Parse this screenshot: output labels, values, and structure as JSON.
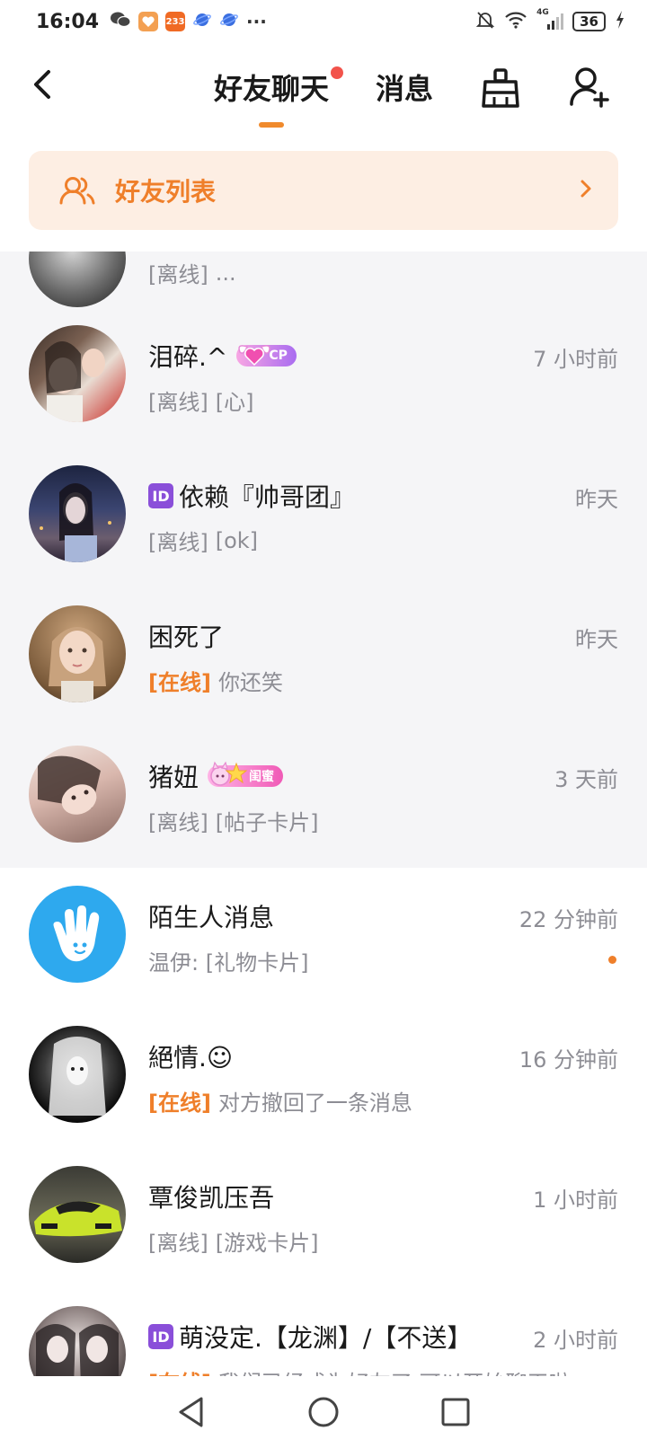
{
  "status_bar": {
    "time": "16:04",
    "badge_233": "233",
    "dots": "···",
    "network": "4G",
    "battery": "36"
  },
  "header": {
    "tabs": [
      {
        "label": "好友聊天",
        "active": true,
        "has_dot": true
      },
      {
        "label": "消息",
        "active": false
      }
    ]
  },
  "friend_list_banner": {
    "label": "好友列表"
  },
  "conversations": [
    {
      "partial": true,
      "name": "",
      "status": "[离线]",
      "preview": "...",
      "time": ""
    },
    {
      "name": "泪碎.^",
      "badge": "CP",
      "status": "[离线]",
      "preview": "[心]",
      "time": "7 小时前"
    },
    {
      "name": "依赖『帅哥团』",
      "id_badge": "ID",
      "status": "[离线]",
      "preview": "[ok]",
      "time": "昨天"
    },
    {
      "name": "困死了",
      "status": "[在线]",
      "online": true,
      "preview": "你还笑",
      "time": "昨天"
    },
    {
      "name": "猪妞",
      "badge": "闺蜜",
      "status": "[离线]",
      "preview": "[帖子卡片]",
      "time": "3 天前"
    }
  ],
  "stranger_conversations": [
    {
      "name": "陌生人消息",
      "status": "",
      "preview": "温伊: [礼物卡片]",
      "time": "22 分钟前",
      "unread": true
    },
    {
      "name": "絕情.☺",
      "status": "[在线]",
      "online": true,
      "preview": "对方撤回了一条消息",
      "time": "16 分钟前"
    },
    {
      "name": "覃俊凯压吾",
      "status": "[离线]",
      "preview": "[游戏卡片]",
      "time": "1 小时前"
    },
    {
      "name": "萌没定.【龙渊】/【不送】",
      "id_badge": "ID",
      "status": "[在线]",
      "online": true,
      "preview": "我们已经成为好友了,可以开始聊天啦",
      "time": "2 小时前"
    }
  ],
  "colors": {
    "accent": "#ef7f2a",
    "banner_bg": "#fdeee3",
    "friends_bg": "#f5f5f7",
    "tab_dot": "#f2534b",
    "muted_text": "#8d8d94"
  }
}
